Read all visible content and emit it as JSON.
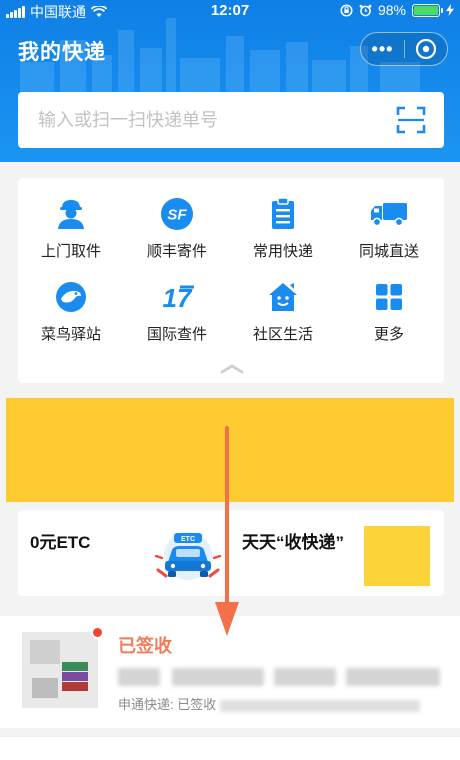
{
  "status_bar": {
    "carrier": "中国联通",
    "time": "12:07",
    "battery_percent": "98%",
    "battery_level": 0.98,
    "battery_color": "#4cd964"
  },
  "header": {
    "title": "我的快递",
    "more_icon": "more-dots-icon",
    "close_icon": "target-close-icon",
    "bg_color": "#1487ee"
  },
  "search": {
    "placeholder": "输入或扫一扫快递单号",
    "value": "",
    "scan_icon": "scan-icon"
  },
  "services": [
    {
      "label": "上门取件",
      "icon": "courier-person-icon"
    },
    {
      "label": "顺丰寄件",
      "icon": "sf-logo-icon"
    },
    {
      "label": "常用快递",
      "icon": "clipboard-icon"
    },
    {
      "label": "同城直送",
      "icon": "delivery-truck-icon"
    },
    {
      "label": "菜鸟驿站",
      "icon": "cainiao-bird-icon"
    },
    {
      "label": "国际查件",
      "icon": "17-track-icon"
    },
    {
      "label": "社区生活",
      "icon": "community-house-icon"
    },
    {
      "label": "更多",
      "icon": "grid-more-icon"
    }
  ],
  "promos": {
    "etc": {
      "label": "0元ETC",
      "icon": "etc-car-icon"
    },
    "tiantian": {
      "label": "天天“收快递”"
    }
  },
  "colors": {
    "accent": "#1a8cf0",
    "banner": "#fdca2f",
    "status_signed": "#f07d5a",
    "arrow": "#f2714a"
  },
  "package": {
    "status": "已签收",
    "detail_prefix": "申通快递: 已签收"
  }
}
